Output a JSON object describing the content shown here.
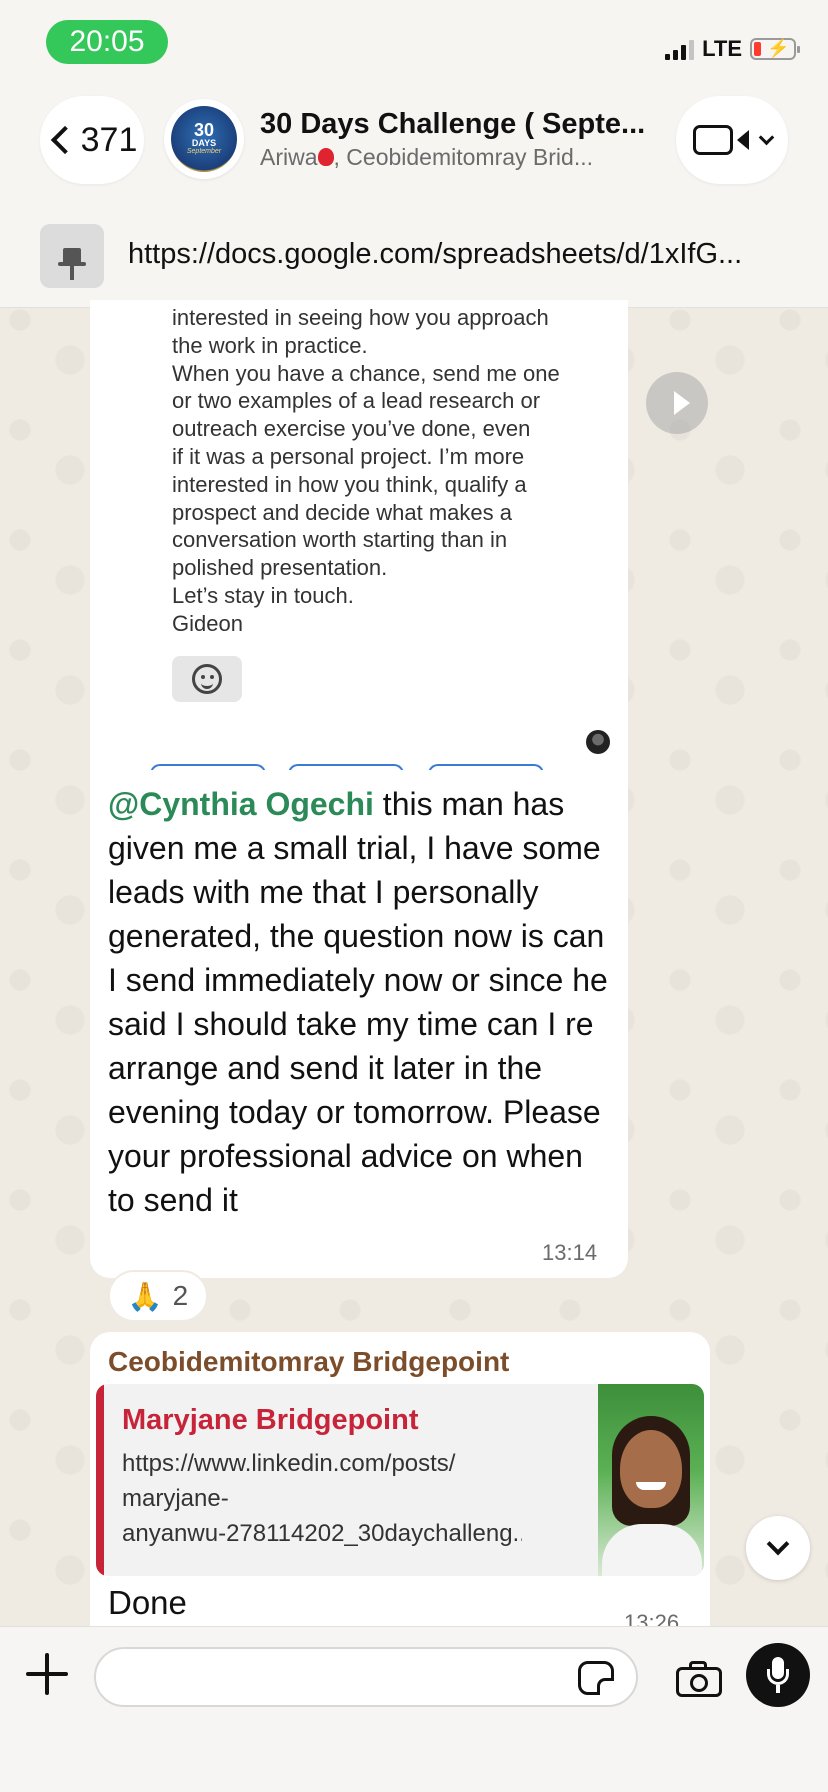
{
  "status_bar": {
    "time": "20:05",
    "network": "LTE",
    "signal_bars": 3,
    "battery_level": "low"
  },
  "header": {
    "back_count": "371",
    "title": "30 Days Challenge ( Septe...",
    "subtitle_name_1": "Ariwa",
    "subtitle_rest": ", Ceobidemitomray Brid...",
    "avatar_text": {
      "line1": "30",
      "line2": "DAYS",
      "line3": "September"
    },
    "icons": [
      "chevron-left-icon",
      "video-camera-icon",
      "chevron-down-icon"
    ]
  },
  "pinned": {
    "icon": "pin-icon",
    "link": "https://docs.google.com/spreadsheets/d/1xIfG..."
  },
  "messages": [
    {
      "type": "image_with_caption",
      "screenshot_lines": [
        "interested in seeing how you approach",
        "the work in practice.",
        "When you have a chance, send me one",
        "or two examples of a lead research or",
        "outreach exercise you’ve done, even",
        "if it was a personal project. I’m more",
        "interested in how you think, qualify a",
        "prospect and decide what makes a",
        "conversation worth starting than in",
        "polished presentation.",
        "Let’s stay in touch.",
        "Gideon"
      ],
      "mention": "@Cynthia Ogechi",
      "text": " this man has given me a small trial, I have some leads with me that I personally generated, the question now is can I send immediately now or since he said I should take my time can I re arrange and send it later in the evening today or tomorrow. Please your professional advice on when to send it",
      "time": "13:14",
      "reaction": {
        "emoji": "🙏",
        "count": "2"
      }
    },
    {
      "type": "link",
      "sender": "Ceobidemitomray Bridgepoint",
      "card_author": "Maryjane Bridgepoint",
      "card_url_lines": [
        "https://www.linkedin.com/posts/",
        "maryjane-",
        "anyanwu-278114202_30daychalleng..."
      ],
      "text": "Done",
      "time": "13:26"
    }
  ],
  "input": {
    "placeholder": "",
    "value": ""
  },
  "colors": {
    "mention": "#2b8a57",
    "sender_2": "#7c4d2a",
    "card_accent": "#c7243a",
    "time_pill": "#34c759",
    "chat_background": "#efeae2"
  }
}
